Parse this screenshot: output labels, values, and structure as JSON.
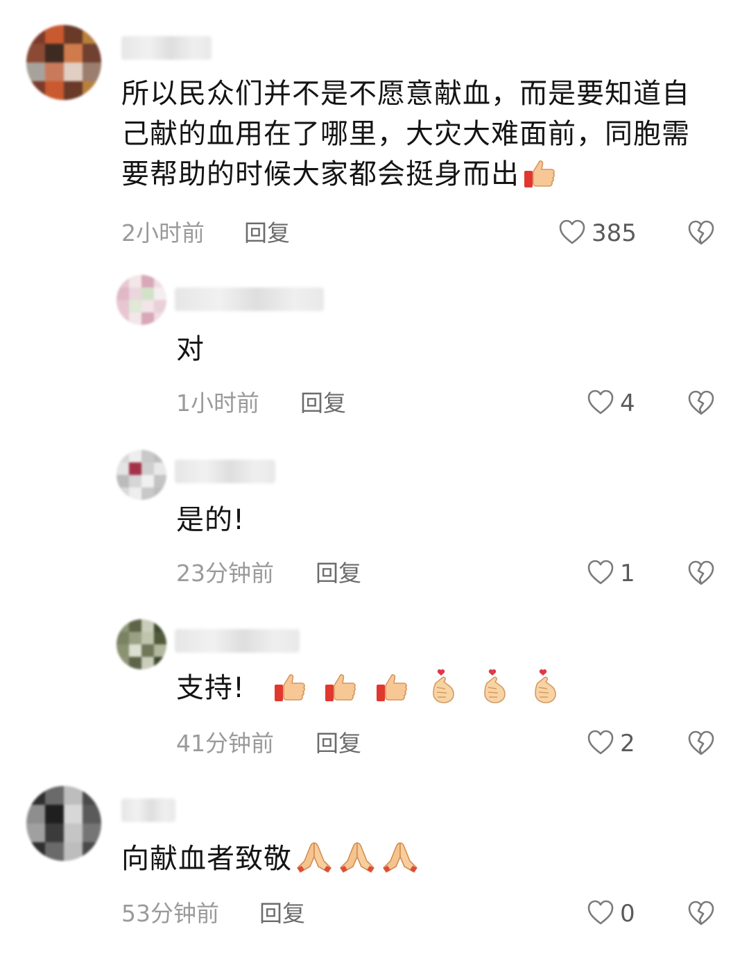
{
  "comments": [
    {
      "text_lines": [
        "所以民众们并不是不愿意献血，而是要知道自",
        "己献的血用在了哪里，大灾大难面前，同胞需",
        "要帮助的时候大家都会挺身而出"
      ],
      "emoji": [
        "thumbs-up"
      ],
      "time": "2小时前",
      "reply": "回复",
      "likes": "385",
      "colors": [
        "#7b3a2c",
        "#c9592f",
        "#6a3a28",
        "#b8803d",
        "#8a4a34",
        "#3d2b22",
        "#d07b4c",
        "#704031",
        "#a8a29c",
        "#c97a5b",
        "#e2cfc3",
        "#9b7e6d"
      ]
    },
    {
      "text_lines": [
        "对"
      ],
      "emoji": [],
      "time": "1小时前",
      "reply": "回复",
      "likes": "4",
      "colors": [
        "#e8c7d2",
        "#f3e6e9",
        "#d8a7b8",
        "#f1dce3",
        "#e0b8c6",
        "#ecd6dd",
        "#d2e2c9",
        "#f5eef0",
        "#e7c6d0",
        "#dfe9d6",
        "#f2e4e8",
        "#e9d0d8"
      ]
    },
    {
      "text_lines": [
        "是的!"
      ],
      "emoji": [],
      "time": "23分钟前",
      "reply": "回复",
      "likes": "1",
      "colors": [
        "#d9d9d9",
        "#eeeeee",
        "#c8c8c8",
        "#bdbdbd",
        "#e4e4e4",
        "#a33247",
        "#cfcfcf",
        "#e9e9e9",
        "#bbbbbb",
        "#d6d6d6",
        "#f0f0f0",
        "#c4c4c4"
      ]
    },
    {
      "text_lines": [
        "支持!"
      ],
      "emoji": [
        "thumbs-up",
        "thumbs-up",
        "thumbs-up",
        "finger-heart",
        "finger-heart",
        "finger-heart"
      ],
      "time": "41分钟前",
      "reply": "回复",
      "likes": "2",
      "colors": [
        "#8e9576",
        "#5d6448",
        "#c9cdbb",
        "#3f4a30",
        "#7a8263",
        "#9aa083",
        "#bfc4ad",
        "#505a3b",
        "#8a9272",
        "#dcdfd2",
        "#6e7758",
        "#b2b79e"
      ]
    },
    {
      "text_lines": [
        "向献血者致敬"
      ],
      "emoji": [
        "folded-hands",
        "folded-hands",
        "folded-hands"
      ],
      "time": "53分钟前",
      "reply": "回复",
      "likes": "0",
      "colors": [
        "#2f2f2f",
        "#6a6a6a",
        "#bdbdbd",
        "#4a4a4a",
        "#8e8e8e",
        "#1f1f1f",
        "#d7d7d7",
        "#5a5a5a",
        "#a0a0a0",
        "#3b3b3b",
        "#c5c5c5",
        "#757575"
      ]
    }
  ]
}
